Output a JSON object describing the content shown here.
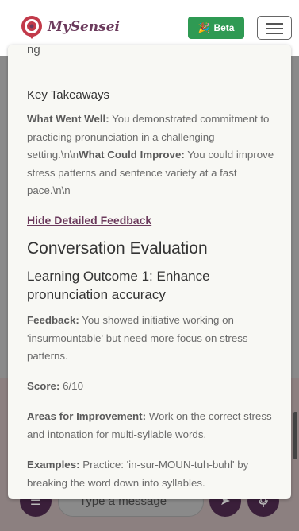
{
  "header": {
    "brand": "MySensei",
    "beta_label": "Beta",
    "beta_icon": "🎉"
  },
  "composer": {
    "placeholder": "Type a message"
  },
  "modal": {
    "cut_text": "ng",
    "key_takeaways_title": "Key Takeaways",
    "went_well_label": "What Went Well:",
    "went_well_text": " You demonstrated commitment to practicing pronunciation in a challenging setting.\\n\\n",
    "could_improve_label": "What Could Improve:",
    "could_improve_text": " You could improve stress patterns and sentence variety at a fast pace.\\n\\n",
    "hide_link": "Hide Detailed Feedback",
    "eval_title": "Conversation Evaluation",
    "learning_outcome": "Learning Outcome 1: Enhance pronunciation accuracy",
    "feedback_label": "Feedback:",
    "feedback_text": " You showed initiative working on 'insurmountable' but need more focus on stress patterns.",
    "score_label": "Score:",
    "score_text": " 6/10",
    "areas_label": "Areas for Improvement:",
    "areas_text": " Work on the correct stress and intonation for multi-syllable words.",
    "examples_label": "Examples:",
    "examples_text": " Practice: 'in-sur-MOUN-tuh-buhl' by breaking the word down into syllables."
  }
}
